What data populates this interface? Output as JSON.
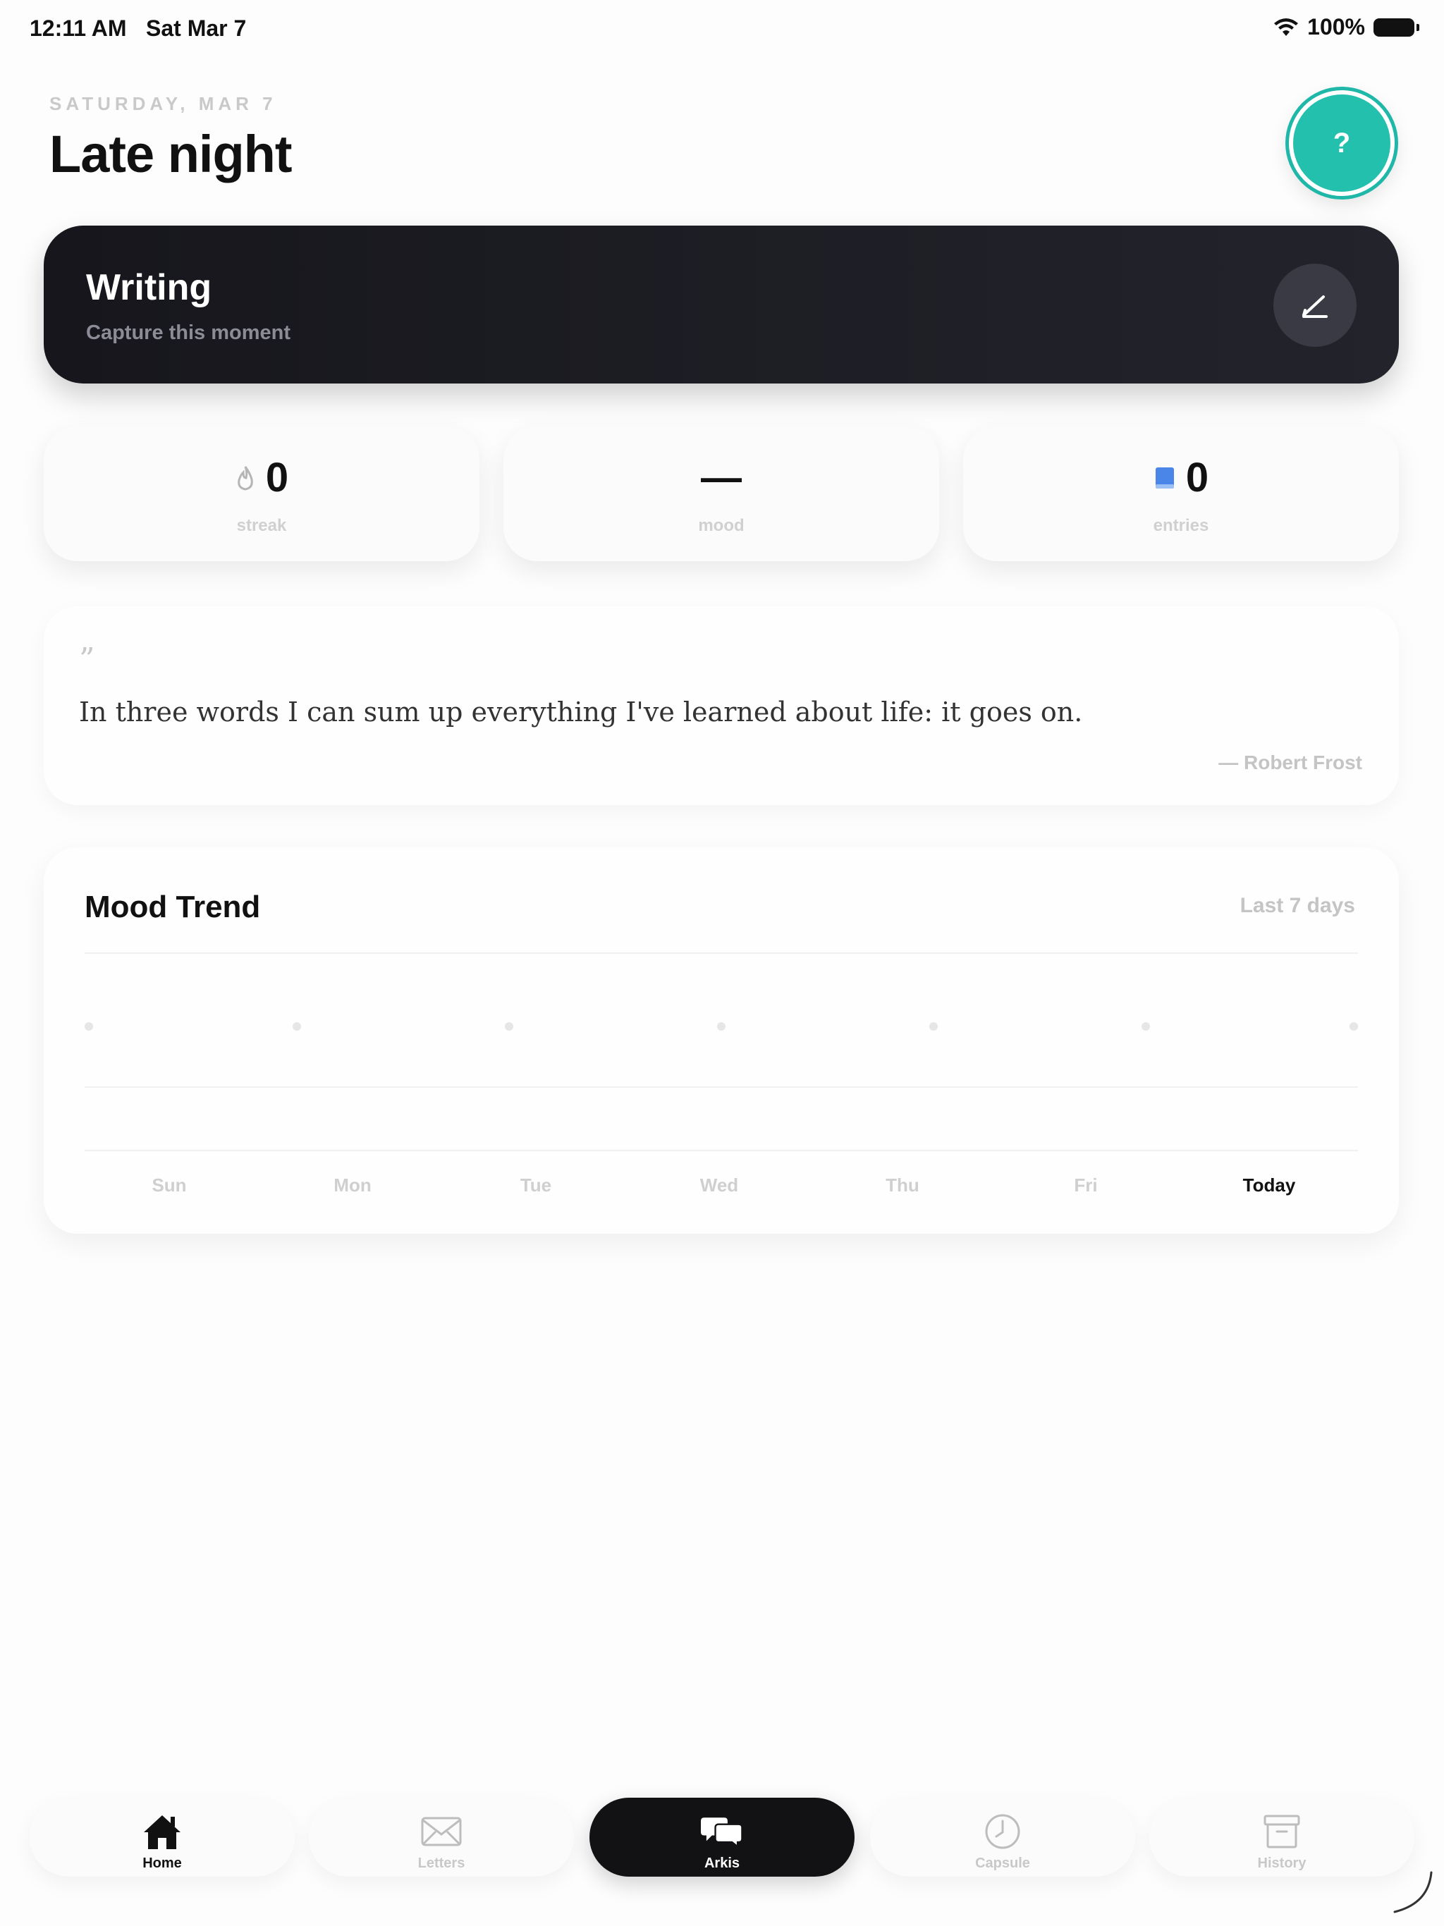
{
  "status_bar": {
    "time": "12:11 AM",
    "date": "Sat Mar 7",
    "battery": "100%"
  },
  "header": {
    "eyebrow": "SATURDAY, MAR 7",
    "title": "Late night",
    "help_label": "?"
  },
  "writing_card": {
    "title": "Writing",
    "subtitle": "Capture this moment"
  },
  "stats": [
    {
      "icon": "flame-icon",
      "value": "0",
      "label": "streak"
    },
    {
      "icon": "",
      "value": "—",
      "label": "mood"
    },
    {
      "icon": "book-icon",
      "value": "0",
      "label": "entries"
    }
  ],
  "quote": {
    "mark": "”",
    "text": "In three words I can sum up everything I've learned about life: it goes on.",
    "author": "— Robert Frost"
  },
  "mood_trend": {
    "title": "Mood Trend",
    "range": "Last 7 days",
    "days": [
      "Sun",
      "Mon",
      "Tue",
      "Wed",
      "Thu",
      "Fri",
      "Today"
    ]
  },
  "chart_data": {
    "type": "line",
    "title": "Mood Trend",
    "categories": [
      "Sun",
      "Mon",
      "Tue",
      "Wed",
      "Thu",
      "Fri",
      "Today"
    ],
    "series": [
      {
        "values": [
          null,
          null,
          null,
          null,
          null,
          null,
          null
        ]
      }
    ]
  },
  "tabs": [
    {
      "icon": "house-icon",
      "label": "Home",
      "active": false
    },
    {
      "icon": "envelope-icon",
      "label": "Letters",
      "active": false
    },
    {
      "icon": "chat-bubbles-icon",
      "label": "Arkis",
      "active": true
    },
    {
      "icon": "clock-icon",
      "label": "Capsule",
      "active": false
    },
    {
      "icon": "archive-box-icon",
      "label": "History",
      "active": false
    }
  ],
  "colors": {
    "accent_teal": "#23c1ad",
    "dark_card": "#1a1a21",
    "entries_icon_blue": "#4a86e8"
  }
}
